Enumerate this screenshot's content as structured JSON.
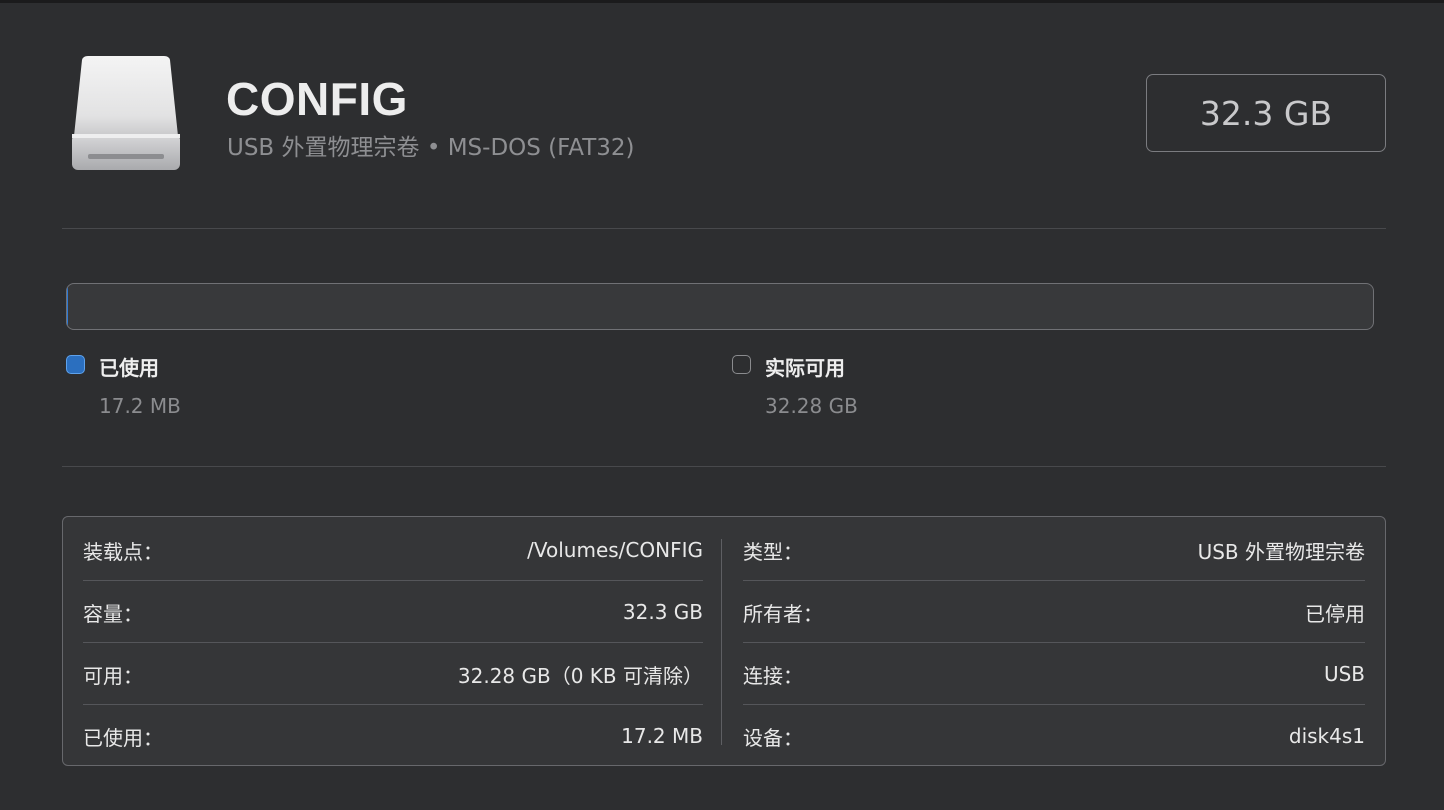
{
  "volume": {
    "name": "CONFIG",
    "subtitle": "USB 外置物理宗卷 • MS-DOS (FAT32)",
    "capacity_badge": "32.3 GB"
  },
  "usage": {
    "used_fraction": 0.00053,
    "legend": [
      {
        "label": "已使用",
        "value": "17.2 MB",
        "color": "#2b6fbf"
      },
      {
        "label": "实际可用",
        "value": "32.28 GB",
        "color": "#8a8b8e"
      }
    ]
  },
  "info": {
    "left": [
      {
        "key": "装载点：",
        "value": "/Volumes/CONFIG"
      },
      {
        "key": "容量：",
        "value": "32.3 GB"
      },
      {
        "key": "可用：",
        "value": "32.28 GB（0 KB 可清除）"
      },
      {
        "key": "已使用：",
        "value": "17.2 MB"
      }
    ],
    "right": [
      {
        "key": "类型：",
        "value": "USB 外置物理宗卷"
      },
      {
        "key": "所有者：",
        "value": "已停用"
      },
      {
        "key": "连接：",
        "value": "USB"
      },
      {
        "key": "设备：",
        "value": "disk4s1"
      }
    ]
  },
  "icons": {
    "drive": "external-drive-icon"
  }
}
